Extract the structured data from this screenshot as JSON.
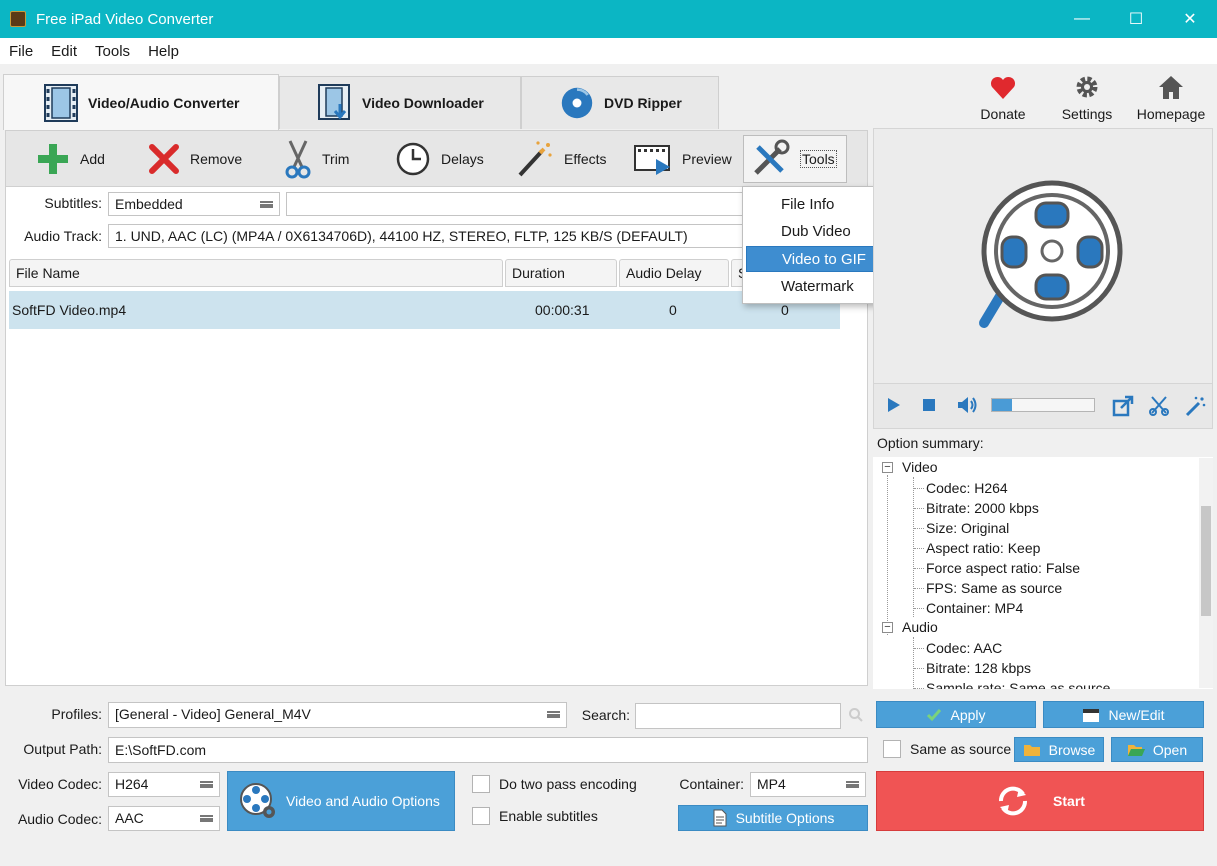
{
  "window": {
    "title": "Free iPad Video Converter",
    "minimize": "—",
    "maximize": "☐",
    "close": "✕"
  },
  "menu": [
    "File",
    "Edit",
    "Tools",
    "Help"
  ],
  "tabs": [
    {
      "label": "Video/Audio Converter",
      "icon": "film-icon",
      "active": true
    },
    {
      "label": "Video Downloader",
      "icon": "film-download-icon",
      "active": false
    },
    {
      "label": "DVD Ripper",
      "icon": "disc-icon",
      "active": false
    }
  ],
  "top_actions": [
    {
      "label": "Donate",
      "icon": "heart-icon",
      "color": "#e0292e"
    },
    {
      "label": "Settings",
      "icon": "gear-icon",
      "color": "#555555"
    },
    {
      "label": "Homepage",
      "icon": "home-icon",
      "color": "#555555"
    }
  ],
  "toolbar": {
    "add": "Add",
    "remove": "Remove",
    "trim": "Trim",
    "delays": "Delays",
    "effects": "Effects",
    "preview": "Preview",
    "tools": "Tools"
  },
  "subtitles": {
    "label": "Subtitles:",
    "value": "Embedded"
  },
  "audio_track": {
    "label": "Audio Track:",
    "value": "1. UND, AAC (LC) (MP4A / 0X6134706D), 44100 HZ, STEREO, FLTP, 125 KB/S (DEFAULT)"
  },
  "table": {
    "headers": [
      "File Name",
      "Duration",
      "Audio Delay",
      "S"
    ],
    "rows": [
      {
        "file_name": "SoftFD Video.mp4",
        "duration": "00:00:31",
        "audio_delay": "0",
        "sub_delay": "0"
      }
    ]
  },
  "tools_menu": {
    "items": [
      "File Info",
      "Dub Video",
      "Video to GIF",
      "Watermark"
    ],
    "highlighted": "Video to GIF"
  },
  "player": {
    "progress": 0.2
  },
  "option_summary": {
    "label": "Option summary:",
    "video_title": "Video",
    "video": [
      "Codec: H264",
      "Bitrate: 2000 kbps",
      "Size:  Original",
      "Aspect ratio: Keep",
      "Force aspect ratio: False",
      "FPS: Same as source",
      "Container: MP4"
    ],
    "audio_title": "Audio",
    "audio": [
      "Codec: AAC",
      "Bitrate: 128 kbps",
      "Sample rate: Same as source"
    ]
  },
  "bottom": {
    "profiles_label": "Profiles:",
    "profiles_value": "[General - Video] General_M4V",
    "search_label": "Search:",
    "search_value": "",
    "apply": "Apply",
    "new_edit": "New/Edit",
    "output_label": "Output Path:",
    "output_value": "E:\\SoftFD.com",
    "same_as_source": "Same as source",
    "browse": "Browse",
    "open": "Open",
    "video_codec_label": "Video Codec:",
    "video_codec_value": "H264",
    "audio_codec_label": "Audio Codec:",
    "audio_codec_value": "AAC",
    "video_audio_options": "Video and Audio Options",
    "two_pass": "Do two pass encoding",
    "enable_subtitles": "Enable subtitles",
    "container_label": "Container:",
    "container_value": "MP4",
    "subtitle_options": "Subtitle Options",
    "start": "Start"
  },
  "colors": {
    "titlebar": "#0bb6c4",
    "accent_blue": "#4ba0d8",
    "start_red": "#f05454",
    "selection": "#cde3ee",
    "menu_highlight": "#3e8dd0"
  }
}
